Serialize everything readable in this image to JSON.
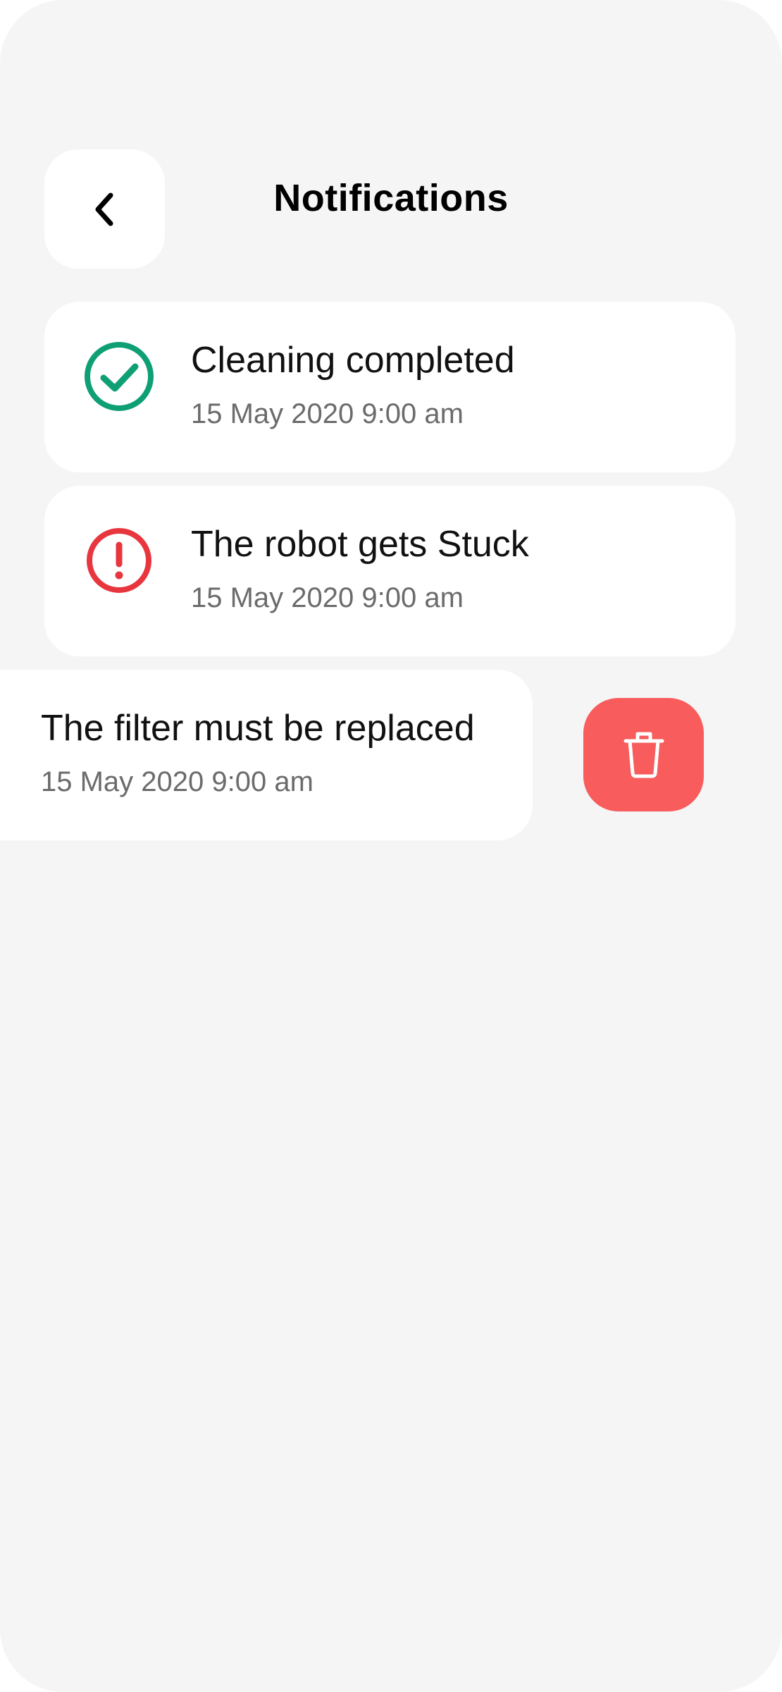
{
  "header": {
    "title": "Notifications",
    "back_icon": "chevron-left-icon"
  },
  "notifications": [
    {
      "title": "Cleaning completed",
      "time": "15 May 2020 9:00 am",
      "icon": "check-circle-icon",
      "color": "#0e9f74"
    },
    {
      "title": "The robot gets Stuck",
      "time": "15 May 2020 9:00 am",
      "icon": "alert-circle-icon",
      "color": "#e8363f"
    },
    {
      "title": "The filter must be replaced",
      "time": "15 May 2020 9:00 am",
      "swiped": true
    }
  ],
  "delete_action": {
    "icon": "trash-icon",
    "color": "#f85c5c"
  },
  "colors": {
    "background": "#f5f5f5",
    "card": "#ffffff",
    "secondary_text": "#6b6b6b"
  }
}
